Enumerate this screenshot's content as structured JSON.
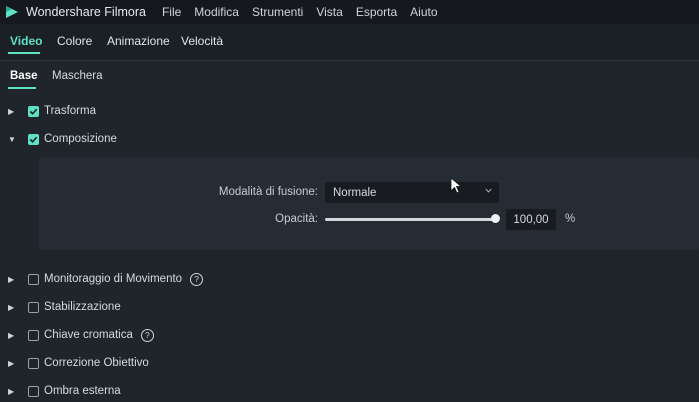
{
  "titlebar": {
    "app_title": "Wondershare Filmora",
    "menu": [
      "File",
      "Modifica",
      "Strumenti",
      "Vista",
      "Esporta",
      "Aiuto"
    ]
  },
  "tabs": [
    "Video",
    "Colore",
    "Animazione",
    "Velocità"
  ],
  "active_tab": "Video",
  "subtabs": [
    "Base",
    "Maschera"
  ],
  "active_subtab": "Base",
  "sections": {
    "trasforma": {
      "label": "Trasforma",
      "checked": true,
      "expanded": false
    },
    "composizione": {
      "label": "Composizione",
      "checked": true,
      "expanded": true
    },
    "monitoraggio": {
      "label": "Monitoraggio di Movimento",
      "checked": false,
      "help_icon": "?"
    },
    "stabilizzazione": {
      "label": "Stabilizzazione",
      "checked": false
    },
    "chiave": {
      "label": "Chiave cromatica",
      "checked": false,
      "help_icon": "?"
    },
    "correzione": {
      "label": "Correzione Obiettivo",
      "checked": false
    },
    "ombra": {
      "label": "Ombra esterna",
      "checked": false
    }
  },
  "composition": {
    "blend_label": "Modalità di fusione:",
    "blend_value": "Normale",
    "opacity_label": "Opacità:",
    "opacity_value": "100,00",
    "opacity_level": 1.0,
    "opacity_unit": "%"
  },
  "colors": {
    "accent": "#5ee0c4",
    "background": "#1f252b",
    "panel": "#252c33"
  },
  "icons": [
    "filmora-logo-icon",
    "expand-arrow-icon",
    "checkbox-icon",
    "help-icon",
    "chevron-down-icon",
    "mouse-cursor-icon"
  ]
}
